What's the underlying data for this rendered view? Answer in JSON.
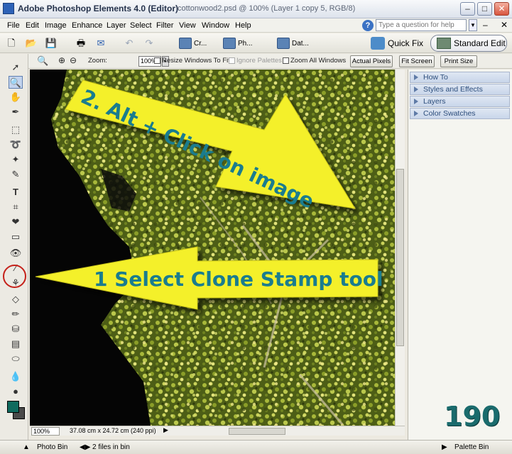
{
  "window": {
    "app_title": "Adobe Photoshop Elements 4.0 (Editor)",
    "doc_title": "cottonwood2.psd @ 100% (Layer 1 copy 5, RGB/8)",
    "min_label": "–",
    "max_label": "□",
    "close_label": "✕"
  },
  "menu": [
    "File",
    "Edit",
    "Image",
    "Enhance",
    "Layer",
    "Select",
    "Filter",
    "View",
    "Window",
    "Help"
  ],
  "help": {
    "placeholder": "Type a question for help",
    "icon": "?"
  },
  "shortcuts": {
    "create_label": "Cr...",
    "photo_label": "Ph...",
    "date_label": "Dat...",
    "quick_fix": "Quick Fix",
    "standard_edit": "Standard Edit"
  },
  "options_bar": {
    "zoom_label": "Zoom:",
    "zoom_value": "100%",
    "resize_label": "Resize Windows To Fit",
    "ignore_label": "Ignore Palettes",
    "zoom_all_label": "Zoom All Windows",
    "actual_pixels": "Actual Pixels",
    "fit_screen": "Fit Screen",
    "print_size": "Print Size"
  },
  "palettes": [
    "How To",
    "Styles and Effects",
    "Layers",
    "Color Swatches"
  ],
  "status": {
    "zoom": "100%",
    "info": "37.08 cm x 24.72 cm (240 ppi)"
  },
  "bottom": {
    "photo_bin": "Photo Bin",
    "files": "2 files in bin",
    "palette_bin": "Palette Bin"
  },
  "annotations": {
    "arrow_top": "2. Alt + Click on image",
    "arrow_bottom": "1 Select Clone Stamp tool",
    "page_number": "190"
  },
  "colors": {
    "foreground": "#0f6a5e",
    "background": "#4a4a4a",
    "arrow_fill": "#f4f02a",
    "annotation_text": "#1a7c8e"
  }
}
